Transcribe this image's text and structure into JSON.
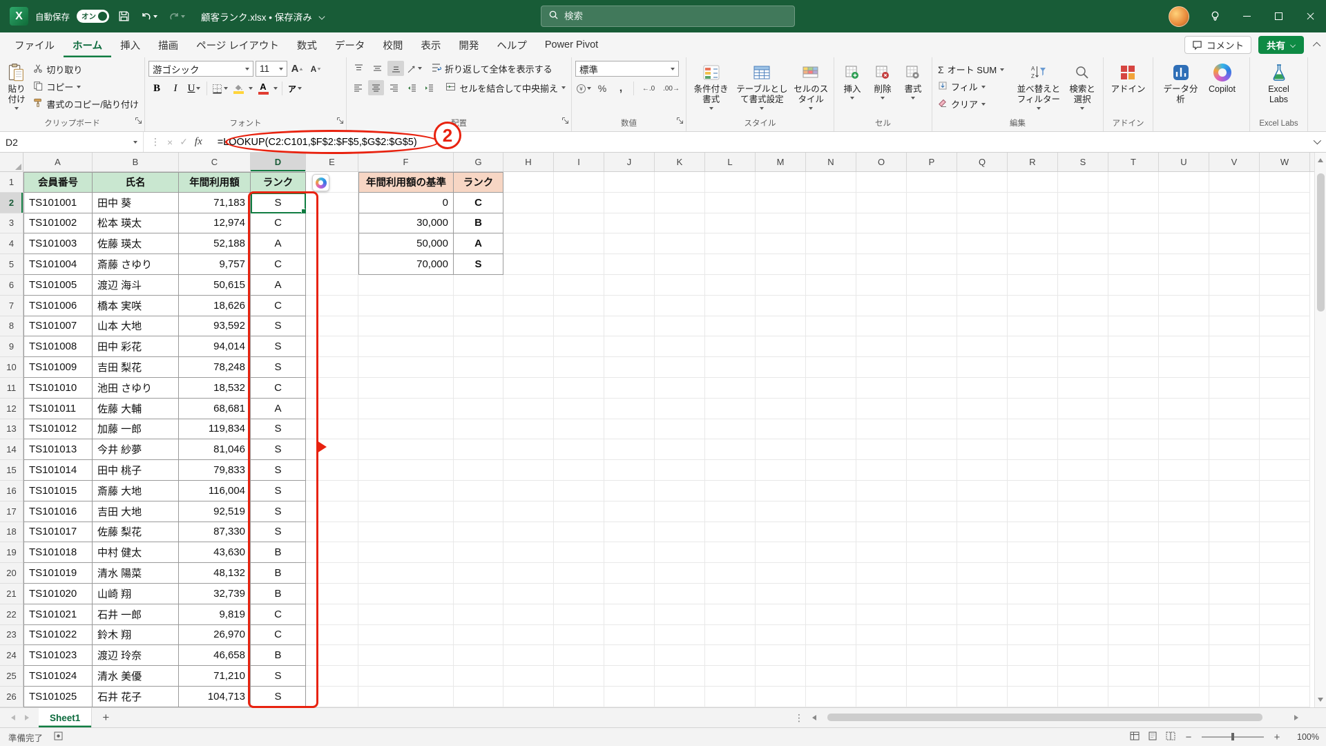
{
  "colors": {
    "title_green": "#185c37",
    "accent_green": "#107c41",
    "annotation_red": "#e8220f",
    "header_green": "#c9e7d0",
    "header_salmon": "#f7d6c4"
  },
  "title_bar": {
    "autosave_label": "自動保存",
    "autosave_state": "オン",
    "filename": "顧客ランク.xlsx • 保存済み",
    "search_placeholder": "検索"
  },
  "tabs": {
    "items": [
      "ファイル",
      "ホーム",
      "挿入",
      "描画",
      "ページ レイアウト",
      "数式",
      "データ",
      "校閲",
      "表示",
      "開発",
      "ヘルプ",
      "Power Pivot"
    ],
    "active": "ホーム",
    "comments_label": "コメント",
    "share_label": "共有"
  },
  "ribbon": {
    "clipboard": {
      "group_label": "クリップボード",
      "paste": "貼り付け",
      "cut": "切り取り",
      "copy": "コピー",
      "format_painter": "書式のコピー/貼り付け"
    },
    "font": {
      "group_label": "フォント",
      "font_name": "游ゴシック",
      "font_size": "11"
    },
    "alignment": {
      "group_label": "配置",
      "wrap_text": "折り返して全体を表示する",
      "merge_center": "セルを結合して中央揃え"
    },
    "number": {
      "group_label": "数値",
      "format": "標準"
    },
    "styles": {
      "group_label": "スタイル",
      "conditional": "条件付き書式",
      "format_as_table": "テーブルとして書式設定",
      "cell_styles": "セルのスタイル"
    },
    "cells": {
      "group_label": "セル",
      "insert": "挿入",
      "delete": "削除",
      "format": "書式"
    },
    "editing": {
      "group_label": "編集",
      "autosum": "オート SUM",
      "fill": "フィル",
      "clear": "クリア",
      "sort_filter": "並べ替えとフィルター",
      "find_select": "検索と選択"
    },
    "addins": {
      "group_label": "アドイン",
      "addins": "アドイン",
      "data_analysis": "データ分析",
      "copilot": "Copilot",
      "excel_labs": "Excel Labs",
      "labs_group_label": "Excel Labs"
    }
  },
  "formula_bar": {
    "cell_ref": "D2",
    "formula": "=LOOKUP(C2:C101,$F$2:$F$5,$G$2:$G$5)"
  },
  "annotation": {
    "step_number": "2"
  },
  "sheet": {
    "col_headers": [
      "A",
      "B",
      "C",
      "D",
      "E",
      "F",
      "G",
      "H",
      "I",
      "J",
      "K",
      "L",
      "M",
      "N",
      "O",
      "P",
      "Q",
      "R",
      "S",
      "T",
      "U",
      "V",
      "W"
    ],
    "row_count": 26,
    "active_cell": "D2",
    "main_table": {
      "headers": [
        "会員番号",
        "氏名",
        "年間利用額",
        "ランク"
      ],
      "rows": [
        [
          "TS101001",
          "田中 葵",
          "71,183",
          "S"
        ],
        [
          "TS101002",
          "松本 瑛太",
          "12,974",
          "C"
        ],
        [
          "TS101003",
          "佐藤 瑛太",
          "52,188",
          "A"
        ],
        [
          "TS101004",
          "斎藤 さゆり",
          "9,757",
          "C"
        ],
        [
          "TS101005",
          "渡辺 海斗",
          "50,615",
          "A"
        ],
        [
          "TS101006",
          "橋本 実咲",
          "18,626",
          "C"
        ],
        [
          "TS101007",
          "山本 大地",
          "93,592",
          "S"
        ],
        [
          "TS101008",
          "田中 彩花",
          "94,014",
          "S"
        ],
        [
          "TS101009",
          "吉田 梨花",
          "78,248",
          "S"
        ],
        [
          "TS101010",
          "池田 さゆり",
          "18,532",
          "C"
        ],
        [
          "TS101011",
          "佐藤 大輔",
          "68,681",
          "A"
        ],
        [
          "TS101012",
          "加藤 一郎",
          "119,834",
          "S"
        ],
        [
          "TS101013",
          "今井 紗夢",
          "81,046",
          "S"
        ],
        [
          "TS101014",
          "田中 桃子",
          "79,833",
          "S"
        ],
        [
          "TS101015",
          "斎藤 大地",
          "116,004",
          "S"
        ],
        [
          "TS101016",
          "吉田 大地",
          "92,519",
          "S"
        ],
        [
          "TS101017",
          "佐藤 梨花",
          "87,330",
          "S"
        ],
        [
          "TS101018",
          "中村 健太",
          "43,630",
          "B"
        ],
        [
          "TS101019",
          "清水 陽菜",
          "48,132",
          "B"
        ],
        [
          "TS101020",
          "山崎 翔",
          "32,739",
          "B"
        ],
        [
          "TS101021",
          "石井 一郎",
          "9,819",
          "C"
        ],
        [
          "TS101022",
          "鈴木 翔",
          "26,970",
          "C"
        ],
        [
          "TS101023",
          "渡辺 玲奈",
          "46,658",
          "B"
        ],
        [
          "TS101024",
          "清水 美優",
          "71,210",
          "S"
        ],
        [
          "TS101025",
          "石井 花子",
          "104,713",
          "S"
        ]
      ]
    },
    "lookup_table": {
      "headers": [
        "年間利用額の基準",
        "ランク"
      ],
      "rows": [
        [
          "0",
          "C"
        ],
        [
          "30,000",
          "B"
        ],
        [
          "50,000",
          "A"
        ],
        [
          "70,000",
          "S"
        ]
      ]
    }
  },
  "sheet_tabs": {
    "tabs": [
      "Sheet1"
    ],
    "active": "Sheet1",
    "add_label": "+"
  },
  "status_bar": {
    "mode": "準備完了",
    "zoom_level": "100%"
  }
}
